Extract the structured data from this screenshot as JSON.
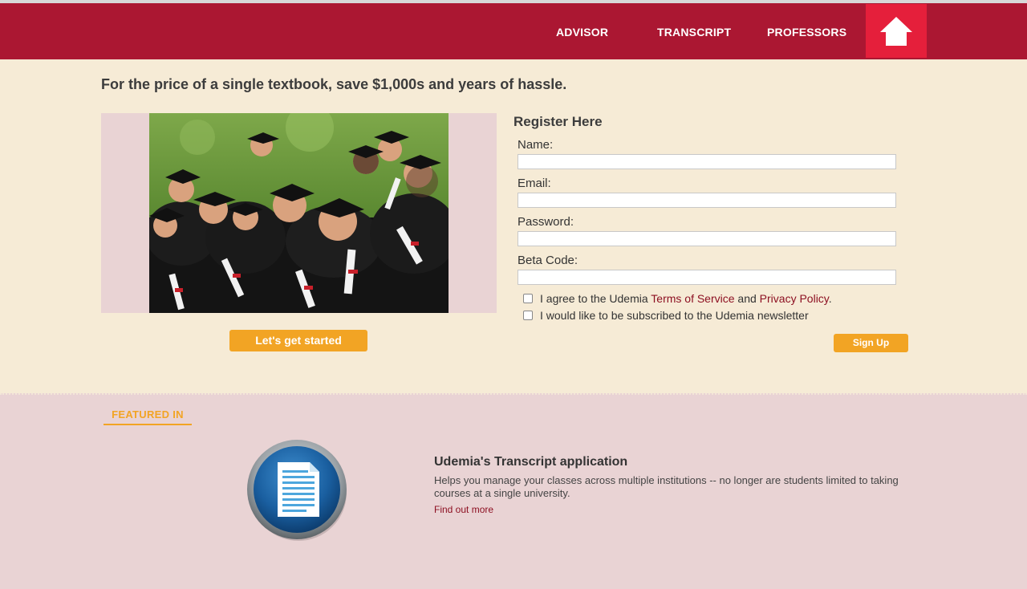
{
  "nav": {
    "items": [
      {
        "label": "ADVISOR"
      },
      {
        "label": "TRANSCRIPT"
      },
      {
        "label": "PROFESSORS"
      }
    ],
    "home_icon": "home-icon"
  },
  "hero": {
    "tagline": "For the price of a single textbook, save $1,000s and years of hassle.",
    "start_button": "Let's get started"
  },
  "register": {
    "title": "Register Here",
    "fields": [
      {
        "label": "Name:",
        "value": ""
      },
      {
        "label": "Email:",
        "value": ""
      },
      {
        "label": "Password:",
        "value": ""
      },
      {
        "label": "Beta Code:",
        "value": ""
      }
    ],
    "agree_prefix": "I agree to the Udemia ",
    "terms_link": "Terms of Service",
    "agree_and": " and ",
    "privacy_link": "Privacy Policy",
    "agree_suffix": ".",
    "newsletter": "I would like to be subscribed to the Udemia newsletter",
    "signup_button": "Sign Up"
  },
  "featured": {
    "heading": "FEATURED IN",
    "icon": "document-icon",
    "app_title": "Udemia's Transcript application",
    "app_description": "Helps you manage your classes across multiple institutions -- no longer are students limited to taking courses at a single university.",
    "find_out_more": "Find out more"
  },
  "colors": {
    "header": "#ab1732",
    "home_button": "#e51f3b",
    "accent_orange": "#f2a424",
    "page_bg": "#f6ebd6",
    "footer_bg": "#e9d3d4",
    "link": "#8d1022"
  }
}
